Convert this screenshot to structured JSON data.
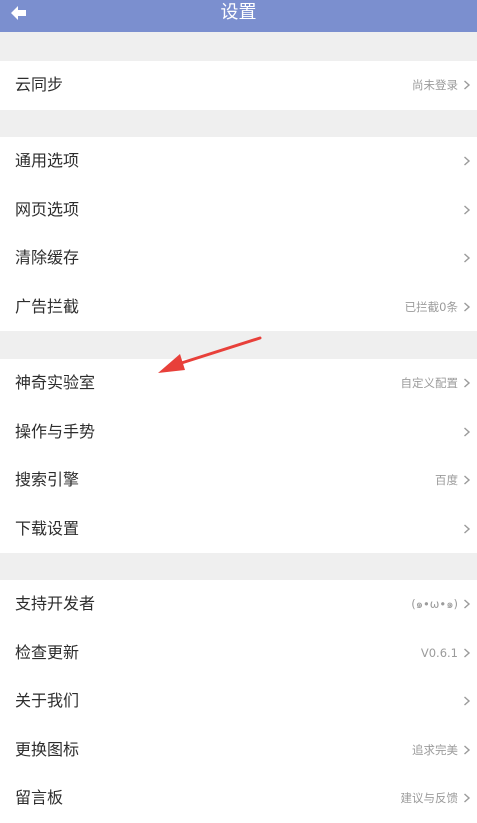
{
  "appbar": {
    "title": "设置",
    "back_icon": "back-arrow-icon"
  },
  "sections": [
    {
      "rows": [
        {
          "label": "云同步",
          "value": "尚未登录"
        }
      ]
    },
    {
      "rows": [
        {
          "label": "通用选项",
          "value": ""
        },
        {
          "label": "网页选项",
          "value": ""
        },
        {
          "label": "清除缓存",
          "value": ""
        },
        {
          "label": "广告拦截",
          "value": "已拦截0条"
        }
      ]
    },
    {
      "rows": [
        {
          "label": "神奇实验室",
          "value": "自定义配置"
        },
        {
          "label": "操作与手势",
          "value": ""
        },
        {
          "label": "搜索引擎",
          "value": "百度"
        },
        {
          "label": "下载设置",
          "value": ""
        }
      ]
    },
    {
      "rows": [
        {
          "label": "支持开发者",
          "value": "(๑•ω•๑)"
        },
        {
          "label": "检查更新",
          "value": "V0.6.1"
        },
        {
          "label": "关于我们",
          "value": ""
        },
        {
          "label": "更换图标",
          "value": "追求完美"
        },
        {
          "label": "留言板",
          "value": "建议与反馈"
        }
      ]
    }
  ],
  "colors": {
    "appbar": "#7b8fcf",
    "background": "#efefef",
    "annotation_arrow": "#e8403a"
  }
}
